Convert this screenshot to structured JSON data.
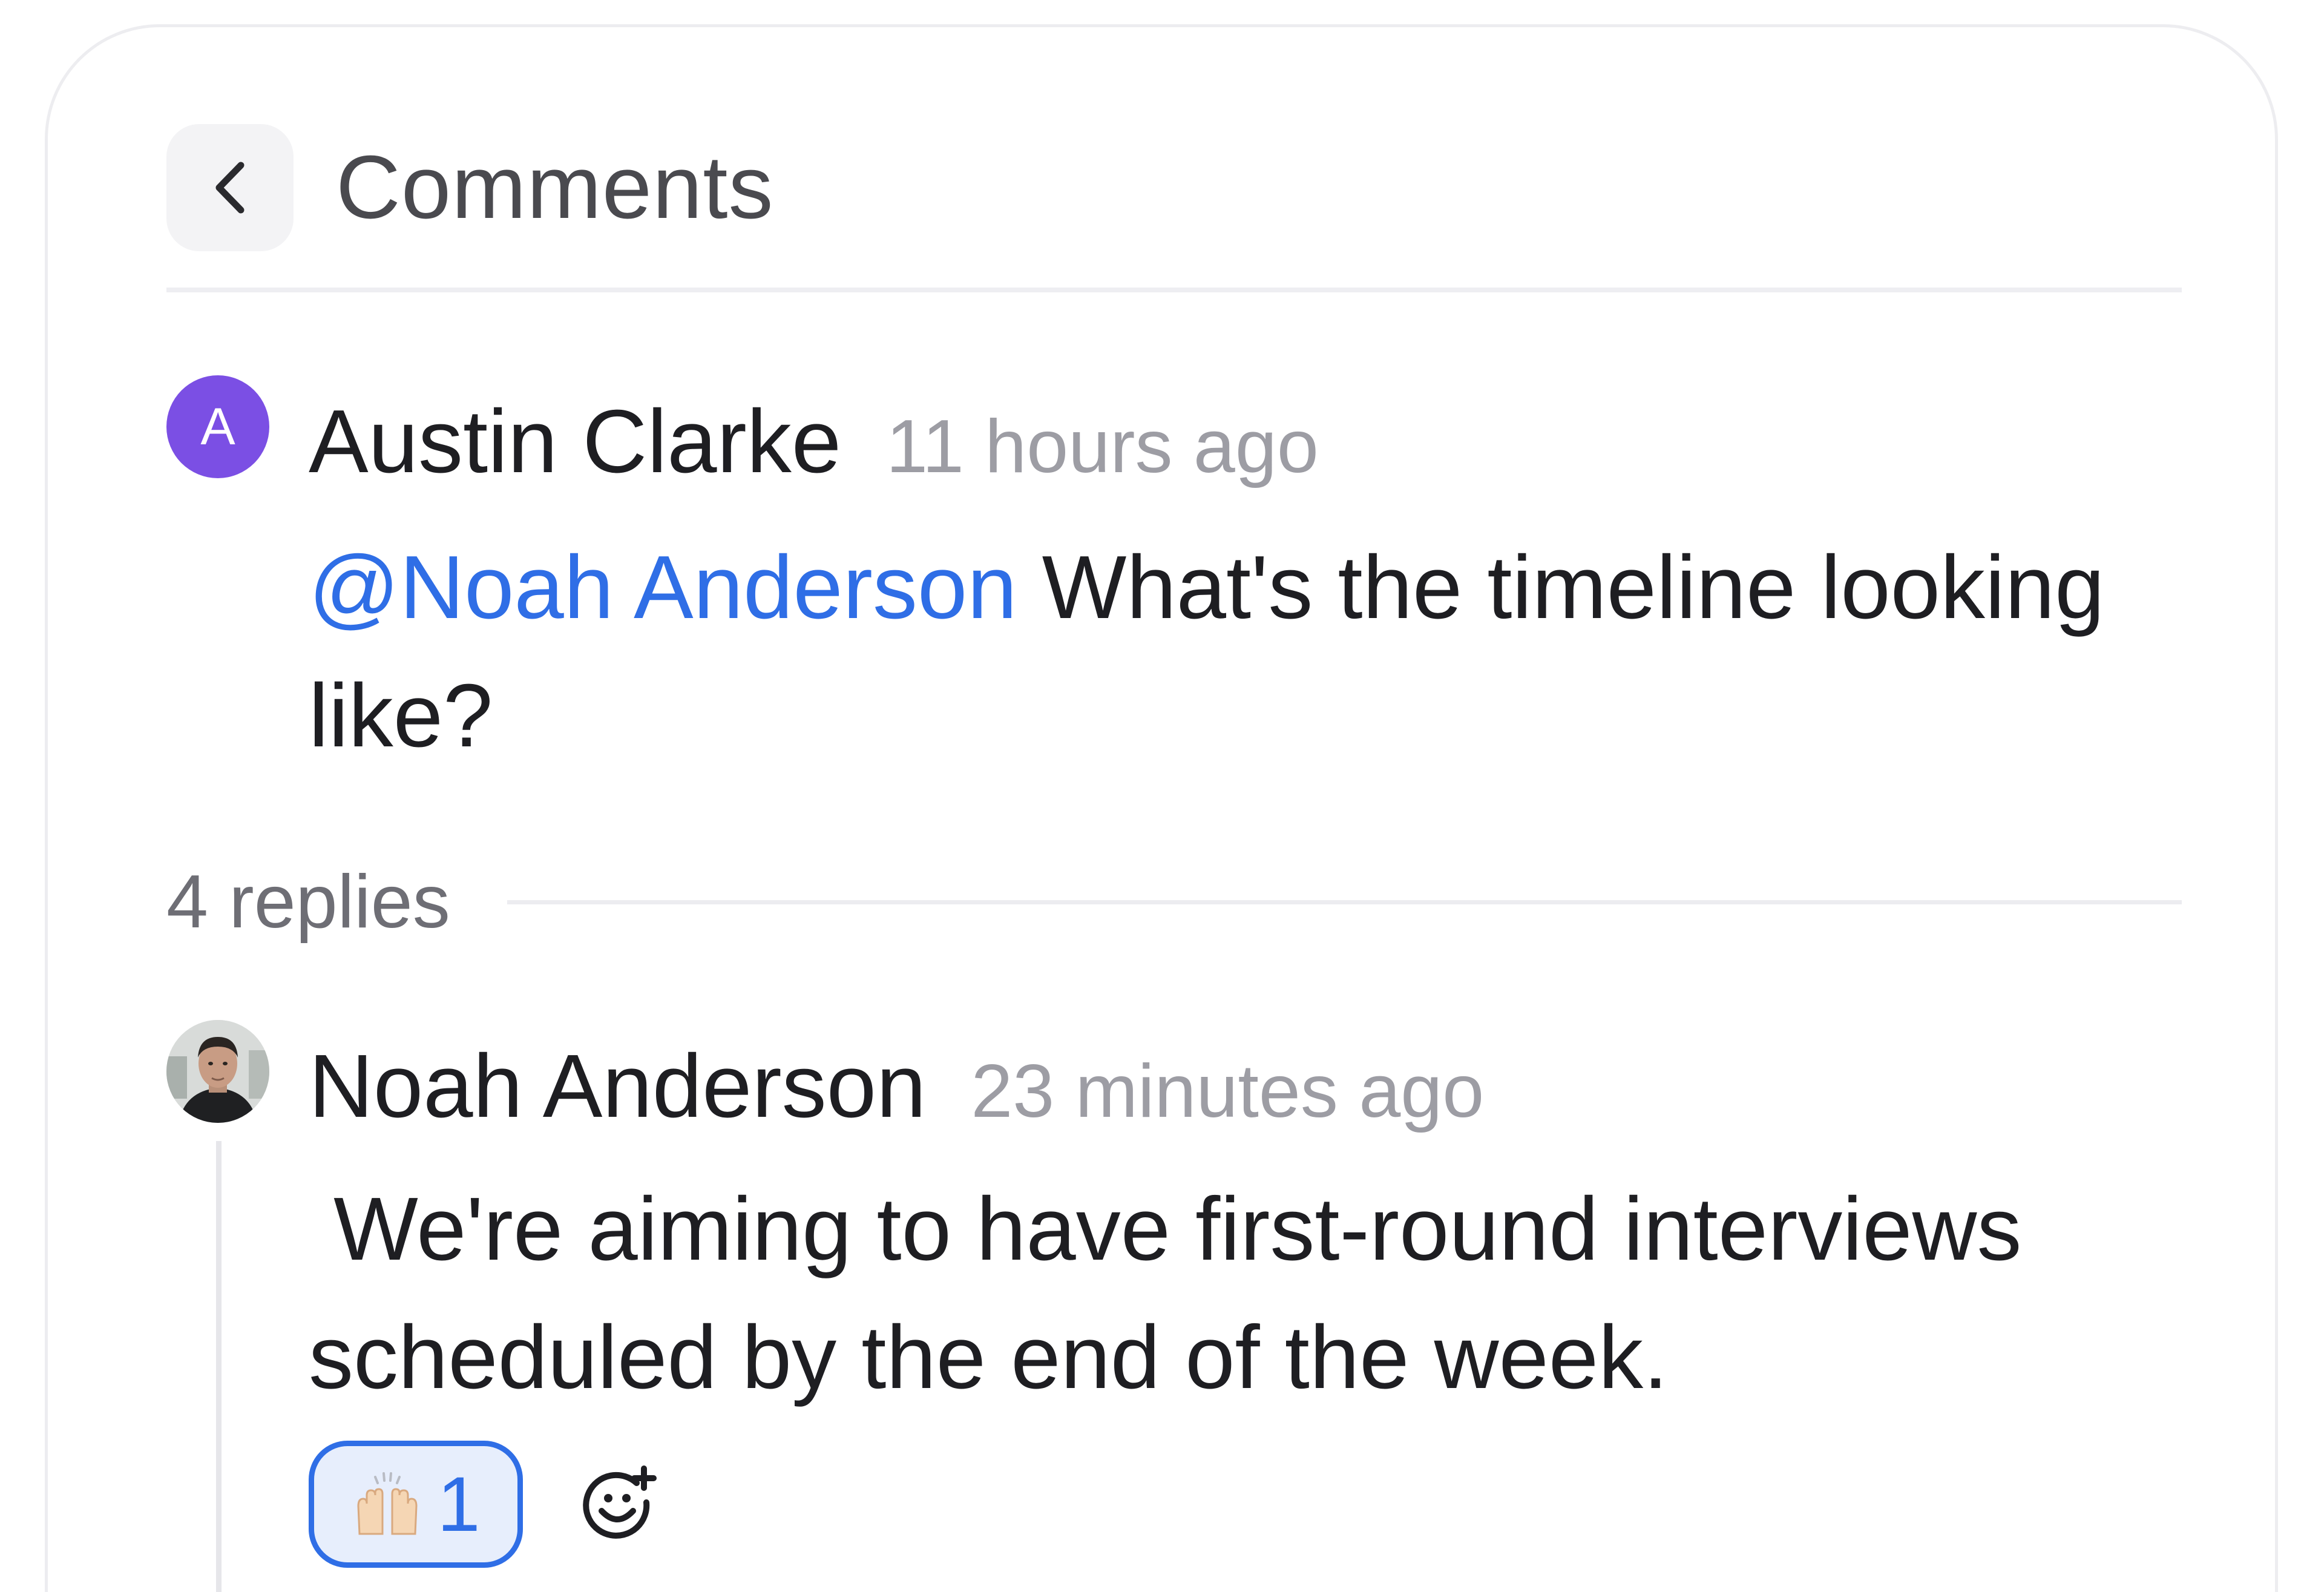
{
  "header": {
    "title": "Comments",
    "back_icon": "chevron-left-icon"
  },
  "comment": {
    "avatar_initial": "A",
    "avatar_color": "#7b4fe4",
    "author": "Austin Clarke",
    "time": "11 hours ago",
    "mention": "@Noah Anderson",
    "text": " What's the timeline looking like?"
  },
  "replies": {
    "count_label": "4 replies"
  },
  "reply": {
    "avatar": "user-photo-avatar",
    "author": "Noah Anderson",
    "time": "23 minutes ago",
    "text": " We're aiming to have first-round interviews scheduled by the end of the week.",
    "reactions": [
      {
        "emoji": "raising-hands-emoji",
        "count": "1"
      }
    ],
    "add_reaction_icon": "add-emoji-icon"
  },
  "colors": {
    "accent": "#2f6ee6",
    "accent_bg": "#e7eefc",
    "text_primary": "#1e1e22",
    "text_muted": "#9d9da4"
  }
}
